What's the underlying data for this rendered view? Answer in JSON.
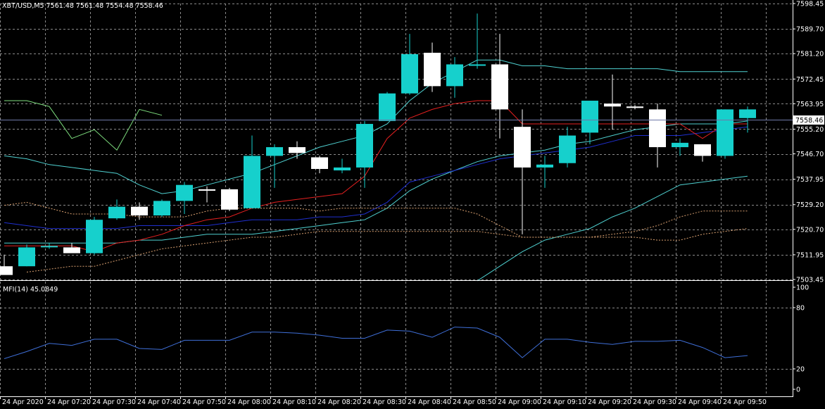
{
  "chart_data": [
    {
      "type": "candlestick",
      "symbol_line": "XBT/USD,M5  7561.48 7561.48 7554.48 7558.46",
      "price_axis": {
        "ticks": [
          "7598.45",
          "7589.70",
          "7581.20",
          "7572.45",
          "7563.95",
          "7555.20",
          "7546.70",
          "7537.95",
          "7529.20",
          "7520.70",
          "7511.95",
          "7503.45"
        ],
        "ylim": [
          7503.45,
          7598.45
        ],
        "current_price": 7558.46,
        "current_price_label": "7558.46"
      },
      "time_axis": {
        "ticks": [
          "24 Apr 2020",
          "24 Apr 07:20",
          "24 Apr 07:30",
          "24 Apr 07:40",
          "24 Apr 07:50",
          "24 Apr 08:00",
          "24 Apr 08:10",
          "24 Apr 08:20",
          "24 Apr 08:30",
          "24 Apr 08:40",
          "24 Apr 08:50",
          "24 Apr 09:00",
          "24 Apr 09:10",
          "24 Apr 09:20",
          "24 Apr 09:30",
          "24 Apr 09:40",
          "24 Apr 09:50"
        ]
      },
      "candles": [
        {
          "o": 7508,
          "h": 7512,
          "l": 7506,
          "c": 7505
        },
        {
          "o": 7508,
          "h": 7515.5,
          "l": 7508,
          "c": 7514.5
        },
        {
          "o": 7515,
          "h": 7516,
          "l": 7514,
          "c": 7515
        },
        {
          "o": 7514.5,
          "h": 7516,
          "l": 7513,
          "c": 7512.5
        },
        {
          "o": 7512.5,
          "h": 7525,
          "l": 7512,
          "c": 7524
        },
        {
          "o": 7524.5,
          "h": 7531,
          "l": 7524,
          "c": 7528.5
        },
        {
          "o": 7528.5,
          "h": 7530,
          "l": 7524,
          "c": 7525.5
        },
        {
          "o": 7525.5,
          "h": 7531,
          "l": 7525,
          "c": 7530.5
        },
        {
          "o": 7530.5,
          "h": 7537,
          "l": 7526,
          "c": 7536
        },
        {
          "o": 7534.5,
          "h": 7535.5,
          "l": 7530,
          "c": 7534
        },
        {
          "o": 7534.5,
          "h": 7535,
          "l": 7527,
          "c": 7527.5
        },
        {
          "o": 7528,
          "h": 7553,
          "l": 7528,
          "c": 7546
        },
        {
          "o": 7546,
          "h": 7550,
          "l": 7535,
          "c": 7549
        },
        {
          "o": 7549,
          "h": 7551,
          "l": 7545,
          "c": 7547
        },
        {
          "o": 7545.5,
          "h": 7546,
          "l": 7540,
          "c": 7541.5
        },
        {
          "o": 7541,
          "h": 7545,
          "l": 7540,
          "c": 7542
        },
        {
          "o": 7542,
          "h": 7558,
          "l": 7535,
          "c": 7557
        },
        {
          "o": 7558,
          "h": 7568,
          "l": 7558,
          "c": 7567.5
        },
        {
          "o": 7567.5,
          "h": 7588,
          "l": 7567,
          "c": 7581
        },
        {
          "o": 7581.5,
          "h": 7585,
          "l": 7568,
          "c": 7570
        },
        {
          "o": 7570,
          "h": 7580,
          "l": 7566,
          "c": 7577.5
        },
        {
          "o": 7577.5,
          "h": 7595,
          "l": 7576,
          "c": 7577.5
        },
        {
          "o": 7577.5,
          "h": 7588,
          "l": 7552,
          "c": 7562
        },
        {
          "o": 7556,
          "h": 7562,
          "l": 7519,
          "c": 7542
        },
        {
          "o": 7542,
          "h": 7546,
          "l": 7535,
          "c": 7543
        },
        {
          "o": 7543.5,
          "h": 7556,
          "l": 7542,
          "c": 7553
        },
        {
          "o": 7554,
          "h": 7565,
          "l": 7550,
          "c": 7565
        },
        {
          "o": 7564,
          "h": 7574,
          "l": 7555,
          "c": 7563
        },
        {
          "o": 7563,
          "h": 7563.5,
          "l": 7562,
          "c": 7562.5
        },
        {
          "o": 7562,
          "h": 7564,
          "l": 7542,
          "c": 7549
        },
        {
          "o": 7549,
          "h": 7552,
          "l": 7546,
          "c": 7550.5
        },
        {
          "o": 7550,
          "h": 7550,
          "l": 7544,
          "c": 7546
        },
        {
          "o": 7546,
          "h": 7562,
          "l": 7545,
          "c": 7562
        },
        {
          "o": 7559,
          "h": 7563,
          "l": 7554,
          "c": 7562
        }
      ],
      "indicators": [
        {
          "color": "#4fd1d1",
          "values": [
            7546,
            7545,
            7543,
            7542,
            7541,
            7540,
            7536,
            7533,
            7534,
            7536,
            7538,
            7540,
            7543,
            7546,
            7549,
            7551,
            7553,
            7557,
            7565,
            7571,
            7575,
            7579,
            7579,
            7577,
            7577,
            7576,
            7576,
            7576,
            7576,
            7576,
            7575,
            7575,
            7575,
            7575
          ]
        },
        {
          "color": "#4fd1d1",
          "values": [
            7516,
            7516,
            7516,
            7516,
            7516,
            7516,
            7517,
            7517,
            7518,
            7519,
            7519,
            7519,
            7520,
            7521,
            7522,
            7523,
            7524,
            7528,
            7534,
            7538,
            7541,
            7544,
            7546,
            7547,
            7548,
            7550,
            7551,
            7553,
            7555,
            7556,
            7557,
            7557,
            7557,
            7558
          ]
        },
        {
          "color": "#4fd1d1",
          "values": [
            null,
            null,
            null,
            null,
            null,
            null,
            null,
            null,
            null,
            null,
            null,
            null,
            null,
            null,
            null,
            null,
            null,
            null,
            null,
            null,
            null,
            7503,
            7508,
            7513,
            7517,
            7519,
            7521,
            7525,
            7528,
            7532,
            7536,
            7537,
            7538,
            7539
          ]
        },
        {
          "color": "#1f2fcf",
          "values": [
            7523,
            7522,
            7521,
            7521,
            7521,
            7521,
            7522,
            7522,
            7522,
            7522,
            7523,
            7524,
            7524,
            7524,
            7525,
            7525,
            7526,
            7530,
            7537,
            7539,
            7541,
            7543,
            7545,
            7546,
            7547,
            7548,
            7549,
            7551,
            7553,
            7553,
            7553,
            7554,
            7555,
            7556
          ]
        },
        {
          "color": "#e62020",
          "values": [
            7515,
            7515,
            7515,
            7515,
            7513,
            7516,
            7517,
            7519,
            7522,
            7524,
            7525,
            7528,
            7530,
            7531,
            7532,
            7533,
            7539,
            7552,
            7559,
            7562,
            7564,
            7565,
            7565,
            7557,
            7557,
            7557,
            7557,
            7557,
            7557,
            7557,
            7557,
            7552,
            7557,
            7557
          ]
        },
        {
          "color": "#7fe07f",
          "values": [
            7565,
            7565,
            7563,
            7552,
            7555,
            7548,
            7562,
            7560,
            null,
            null,
            null,
            null,
            null,
            null,
            null,
            null,
            null,
            null,
            null,
            null,
            null,
            null,
            null,
            null,
            null,
            null,
            null,
            null,
            null,
            null,
            null,
            null,
            null,
            null
          ]
        },
        {
          "color": "#d9a070",
          "dashed": true,
          "values": [
            7529,
            7530,
            7528,
            7526,
            7526,
            7526,
            7525,
            7525,
            7525,
            7527,
            7528,
            7528,
            7528,
            7528,
            7527,
            7528,
            7528,
            7528,
            7528,
            7528,
            7528,
            7526,
            7522,
            7518,
            7518,
            7518,
            7518,
            7519,
            7520,
            7522,
            7525,
            7527,
            7527,
            7527
          ]
        },
        {
          "color": "#d9a070",
          "dashed": true,
          "values": [
            null,
            7506,
            7507,
            7508,
            7508,
            7510,
            7512,
            7514,
            7515,
            7516,
            7517,
            7518,
            7518,
            7519,
            7520,
            7520,
            7520,
            7520,
            7520,
            7520,
            7520,
            7520,
            7519,
            7518,
            7518,
            7518,
            7518,
            7518,
            7518,
            7517,
            7517,
            7519,
            7520,
            7521
          ]
        }
      ]
    },
    {
      "type": "line",
      "title": "MFI(14) 45.0849",
      "axis_ticks": [
        "100",
        "80",
        "20",
        "0"
      ],
      "ylim": [
        0,
        100
      ],
      "series": [
        {
          "values": [
            30,
            37,
            45,
            43,
            49,
            49,
            40,
            39,
            48,
            48,
            48,
            56,
            56,
            55,
            53,
            50,
            50,
            58,
            57,
            51,
            61,
            60,
            51,
            31,
            49,
            49,
            46,
            44,
            47,
            47,
            48,
            41,
            31,
            33
          ]
        }
      ]
    }
  ],
  "colors": {
    "background": "#000000",
    "grid": "#8a8a8a",
    "bull": "#16d0cc",
    "bear": "#ffffff",
    "wick": "#16d0cc",
    "mfi_line": "#3f6fd8",
    "price_line": "#6f78a8"
  }
}
